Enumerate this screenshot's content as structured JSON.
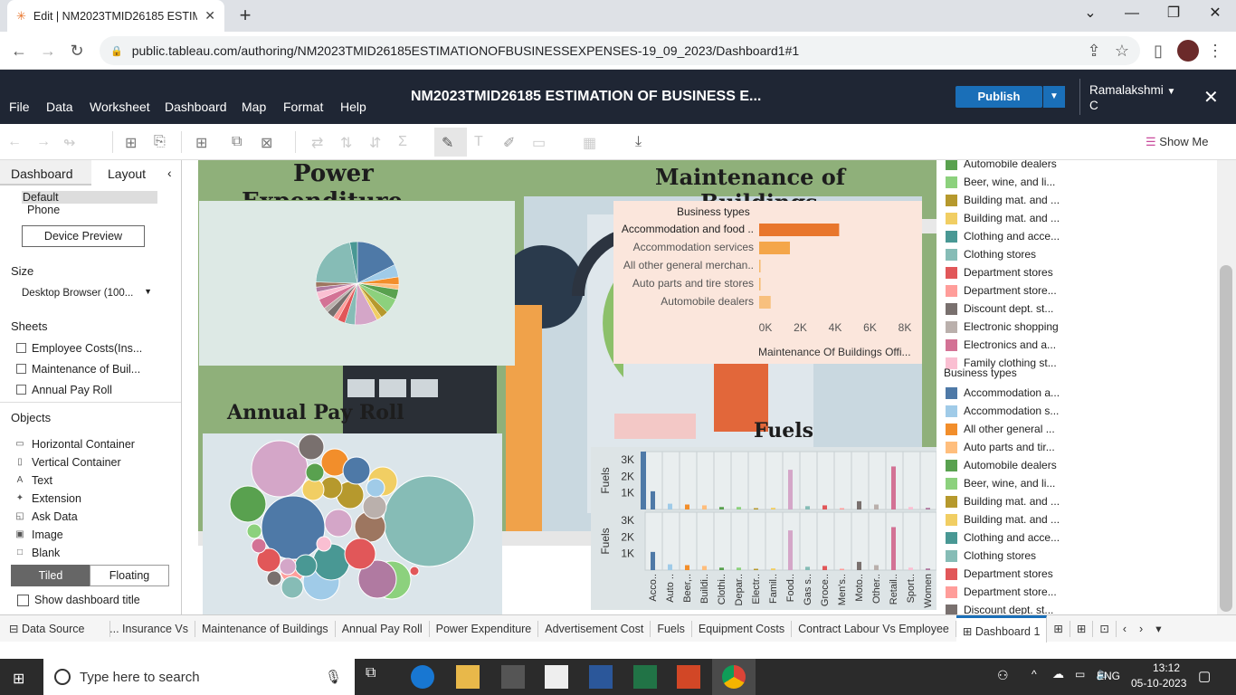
{
  "browser": {
    "tab_title": "Edit | NM2023TMID26185 ESTIM",
    "url": "public.tableau.com/authoring/NM2023TMID26185ESTIMATIONOFBUSINESSEXPENSES-19_09_2023/Dashboard1#1"
  },
  "tableau": {
    "menu": [
      "File",
      "Data",
      "Worksheet",
      "Dashboard",
      "Map",
      "Format",
      "Help"
    ],
    "workbook_title": "NM2023TMID26185 ESTIMATION OF BUSINESS E...",
    "publish_label": "Publish",
    "user_line1": "Ramalakshmi",
    "user_line2": "C",
    "show_me": "Show Me"
  },
  "left_panel": {
    "tab_dashboard": "Dashboard",
    "tab_layout": "Layout",
    "device_default": "Default",
    "device_phone": "Phone",
    "device_preview": "Device Preview",
    "size_header": "Size",
    "size_value": "Desktop Browser (100...",
    "sheets_header": "Sheets",
    "sheets": [
      "Employee Costs(Ins...",
      "Maintenance of Buil...",
      "Annual Pay Roll"
    ],
    "objects_header": "Objects",
    "objects": [
      "Horizontal Container",
      "Vertical Container",
      "Text",
      "Extension",
      "Ask Data",
      "Image",
      "Blank"
    ],
    "tiled": "Tiled",
    "floating": "Floating",
    "show_title": "Show dashboard title"
  },
  "dashboard": {
    "title_power": "Power",
    "title_power2": "Expenditure",
    "title_maint": "Maintenance of",
    "title_maint2": "Buildings",
    "title_payroll": "Annual Pay Roll",
    "title_fuels": "Fuels",
    "maint_header": "Business types",
    "maint_axis_title": "Maintenance Of Buildings Offi...",
    "fuels_axis_label": "Fuels",
    "fuels_yticks": [
      "3K",
      "2K",
      "1K"
    ],
    "fuels_xlabels": [
      "Acco..",
      "Auto ..",
      "Beer,..",
      "Buildi..",
      "Clothi..",
      "Depar..",
      "Electr..",
      "Famil..",
      "Food..",
      "Gas s..",
      "Groce..",
      "Men's..",
      "Moto..",
      "Other..",
      "Retail..",
      "Sport..",
      "Women"
    ]
  },
  "chart_data": [
    {
      "type": "bar",
      "title": "Maintenance of Buildings",
      "categories": [
        "Accommodation and food ..",
        "Accommodation services",
        "All other general merchan..",
        "Auto parts and tire stores",
        "Automobile dealers"
      ],
      "values": [
        5200,
        2000,
        80,
        60,
        750
      ],
      "xlabel": "Maintenance Of Buildings Offi...",
      "ylabel": "Business types",
      "xticks": [
        "0K",
        "2K",
        "4K",
        "6K",
        "8K"
      ],
      "xlim": [
        0,
        9000
      ],
      "colors": [
        "#e8762c",
        "#f4a64a",
        "#f6b869",
        "#f6b869",
        "#f8c07e"
      ]
    },
    {
      "type": "pie",
      "title": "Power Expenditure",
      "values": [
        18,
        5,
        3,
        2,
        4,
        6,
        3,
        2,
        9,
        4,
        3,
        2,
        3,
        2,
        4,
        3,
        2,
        2,
        22,
        3
      ],
      "colors": [
        "#4e79a7",
        "#a0cbe8",
        "#f28e2b",
        "#ffbe7d",
        "#59a14f",
        "#8cd17d",
        "#b6992d",
        "#f1ce63",
        "#d4a6c8",
        "#86bcb6",
        "#e15759",
        "#ff9d9a",
        "#79706e",
        "#bab0ac",
        "#d37295",
        "#fabfd2",
        "#b07aa1",
        "#9d7660",
        "#86bcb6",
        "#499894"
      ]
    },
    {
      "type": "scatter",
      "title": "Annual Pay Roll",
      "values": [
        100,
        40,
        35,
        15,
        12,
        11,
        9,
        8,
        14,
        13,
        11,
        10,
        9,
        9,
        8,
        8,
        7,
        7,
        6,
        6,
        6,
        5,
        5,
        5,
        4,
        4,
        3,
        3,
        2,
        2,
        1
      ]
    },
    {
      "type": "bar",
      "title": "Fuels",
      "categories": [
        "Acco..",
        "Auto ..",
        "Beer,..",
        "Buildi..",
        "Clothi..",
        "Depar..",
        "Electr..",
        "Famil..",
        "Food..",
        "Gas s..",
        "Groce..",
        "Men's..",
        "Moto..",
        "Other..",
        "Retail..",
        "Sport..",
        "Women"
      ],
      "series": [
        {
          "name": "Fuels",
          "values": [
            1100,
            350,
            300,
            250,
            150,
            150,
            80,
            100,
            2400,
            200,
            250,
            80,
            500,
            300,
            2600,
            150,
            100
          ]
        }
      ],
      "ylim": [
        0,
        3500
      ]
    }
  ],
  "legend": {
    "top_items": [
      "Automobile dealers",
      "Beer, wine, and li...",
      "Building mat. and ...",
      "Building mat. and ...",
      "Clothing and acce...",
      "Clothing stores",
      "Department stores",
      "Department store...",
      "Discount dept. st...",
      "Electronic shopping",
      "Electronics and a...",
      "Family clothing st..."
    ],
    "top_colors": [
      "#59a14f",
      "#8cd17d",
      "#b6992d",
      "#f1ce63",
      "#499894",
      "#86bcb6",
      "#e15759",
      "#ff9d9a",
      "#79706e",
      "#bab0ac",
      "#d37295",
      "#fabfd2"
    ],
    "header": "Business types",
    "items": [
      "Accommodation a...",
      "Accommodation s...",
      "All other general ...",
      "Auto parts and tir...",
      "Automobile dealers",
      "Beer, wine, and li...",
      "Building mat. and ...",
      "Building mat. and ...",
      "Clothing and acce...",
      "Clothing stores",
      "Department stores",
      "Department store...",
      "Discount dept. st..."
    ],
    "colors": [
      "#4e79a7",
      "#a0cbe8",
      "#f28e2b",
      "#ffbe7d",
      "#59a14f",
      "#8cd17d",
      "#b6992d",
      "#f1ce63",
      "#499894",
      "#86bcb6",
      "#e15759",
      "#ff9d9a",
      "#79706e"
    ]
  },
  "sheet_tabs": {
    "data_source": "Data Source",
    "tabs": [
      "Insurance Vs ...",
      "Maintenance of Buildings",
      "Annual Pay Roll",
      "Power Expenditure",
      "Advertisement Cost",
      "Fuels",
      "Equipment Costs",
      "Contract Labour Vs Employee"
    ],
    "active": "Dashboard 1"
  },
  "taskbar": {
    "search_placeholder": "Type here to search",
    "lang": "ENG",
    "time": "13:12",
    "date": "05-10-2023"
  }
}
